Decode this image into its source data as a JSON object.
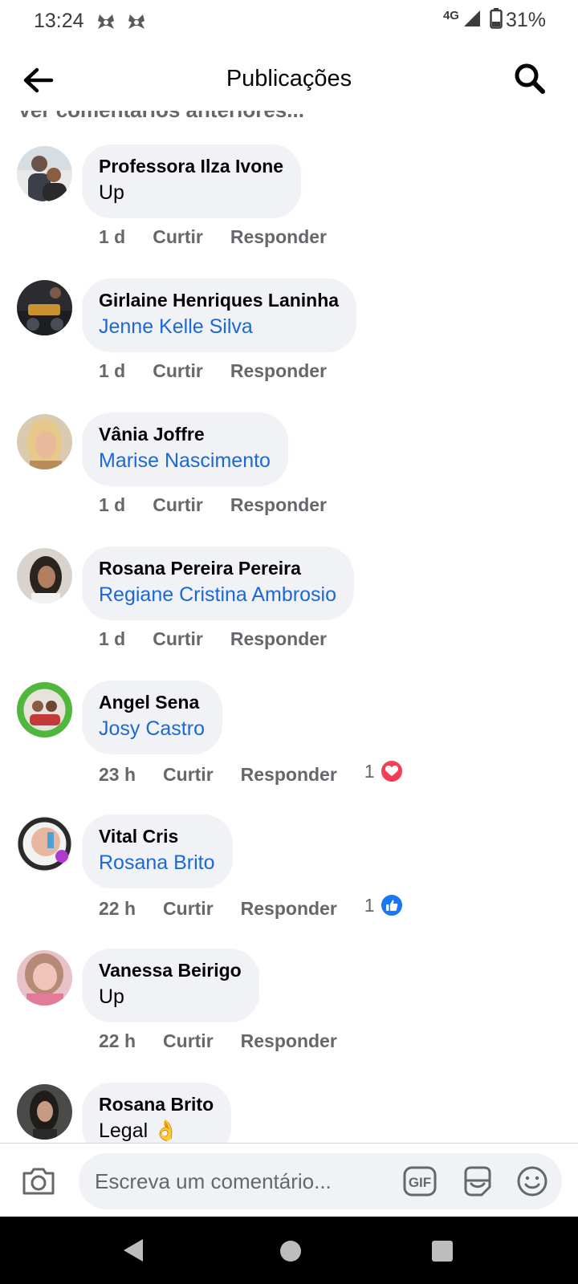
{
  "status_bar": {
    "time": "13:24",
    "network": "4G",
    "battery": "31%",
    "icons": [
      "app-notification-icon",
      "app-notification-icon",
      "signal-icon",
      "battery-icon"
    ]
  },
  "header": {
    "title": "Publicações",
    "back_icon": "arrow-left-icon",
    "search_icon": "search-icon"
  },
  "prev_comments_label": "Ver comentários anteriores...",
  "comments": [
    {
      "author": "Professora Ilza Ivone",
      "text": "Up",
      "is_tag": false,
      "time": "1 d",
      "like": "Curtir",
      "reply": "Responder"
    },
    {
      "author": "Girlaine Henriques Laninha",
      "text": "Jenne Kelle Silva",
      "is_tag": true,
      "time": "1 d",
      "like": "Curtir",
      "reply": "Responder"
    },
    {
      "author": "Vânia Joffre",
      "text": "Marise Nascimento",
      "is_tag": true,
      "time": "1 d",
      "like": "Curtir",
      "reply": "Responder"
    },
    {
      "author": "Rosana Pereira Pereira",
      "text": "Regiane Cristina Ambrosio",
      "is_tag": true,
      "time": "1 d",
      "like": "Curtir",
      "reply": "Responder"
    },
    {
      "author": "Angel Sena",
      "text": "Josy Castro",
      "is_tag": true,
      "time": "23 h",
      "like": "Curtir",
      "reply": "Responder",
      "reaction_count": "1",
      "reaction": "heart-icon"
    },
    {
      "author": "Vital Cris",
      "text": "Rosana Brito",
      "is_tag": true,
      "time": "22 h",
      "like": "Curtir",
      "reply": "Responder",
      "reaction_count": "1",
      "reaction": "thumbs-up-icon"
    },
    {
      "author": "Vanessa Beirigo",
      "text": "Up",
      "is_tag": false,
      "time": "22 h",
      "like": "Curtir",
      "reply": "Responder"
    },
    {
      "author": "Rosana Brito",
      "text": "Legal 👌",
      "is_tag": false
    }
  ],
  "composer": {
    "placeholder": "Escreva um comentário...",
    "icons": [
      "camera-icon",
      "gif-icon",
      "sticker-icon",
      "emoji-icon"
    ]
  },
  "colors": {
    "bubble_bg": "#f0f2f5",
    "tag_blue": "#1b68d6",
    "meta_gray": "#65676b",
    "heart_red": "#f33e58",
    "like_blue": "#1877f2"
  }
}
